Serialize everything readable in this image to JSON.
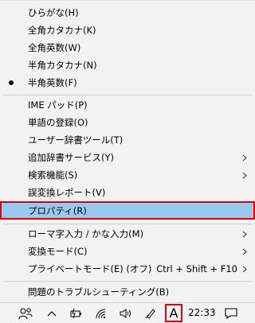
{
  "menu": {
    "items": [
      {
        "label": "ひらがな(H)"
      },
      {
        "label": "全角カタカナ(K)"
      },
      {
        "label": "全角英数(W)"
      },
      {
        "label": "半角カタカナ(N)"
      },
      {
        "label": "半角英数(F)"
      },
      {
        "label": "IME パッド(P)"
      },
      {
        "label": "単語の登録(O)"
      },
      {
        "label": "ユーザー辞書ツール(T)"
      },
      {
        "label": "追加辞書サービス(Y)"
      },
      {
        "label": "検索機能(S)"
      },
      {
        "label": "誤変換レポート(V)"
      },
      {
        "label": "プロパティ(R)"
      },
      {
        "label": "ローマ字入力 / かな入力(M)"
      },
      {
        "label": "変換モード(C)"
      },
      {
        "label": "プライベートモード(E) (オフ)",
        "shortcut": "Ctrl + Shift + F10"
      },
      {
        "label": "問題のトラブルシューティング(B)"
      }
    ]
  },
  "taskbar": {
    "ime_indicator": "A",
    "clock": "22:33"
  },
  "colors": {
    "highlight": "#99c9ef",
    "focus_outline": "#e0000b",
    "menu_bg": "#f2f2f2"
  }
}
